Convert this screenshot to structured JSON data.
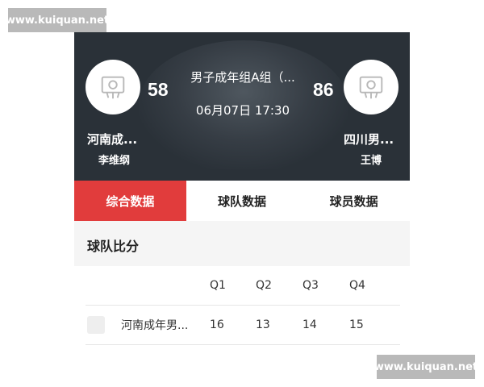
{
  "watermark": {
    "top": "www.kuiquan.net",
    "bottom": "www.kuiquan.net"
  },
  "header": {
    "match_title": "男子成年组A组（...",
    "match_time": "06月07日 17:30",
    "left_team": {
      "name": "河南成...",
      "score": "58",
      "coach": "李维纲",
      "logo_icon": "team-logo-placeholder-icon"
    },
    "right_team": {
      "name": "四川男...",
      "score": "86",
      "coach": "王博",
      "logo_icon": "team-logo-placeholder-icon"
    }
  },
  "tabs": [
    {
      "label": "综合数据",
      "active": true
    },
    {
      "label": "球队数据",
      "active": false
    },
    {
      "label": "球员数据",
      "active": false
    }
  ],
  "section": {
    "title": "球队比分"
  },
  "score_table": {
    "headers": [
      "Q1",
      "Q2",
      "Q3",
      "Q4"
    ],
    "rows": [
      {
        "team": "河南成年男...",
        "q": [
          "16",
          "13",
          "14",
          "15"
        ]
      }
    ]
  },
  "colors": {
    "header_bg": "#2a3138",
    "accent": "#e13c3c"
  }
}
